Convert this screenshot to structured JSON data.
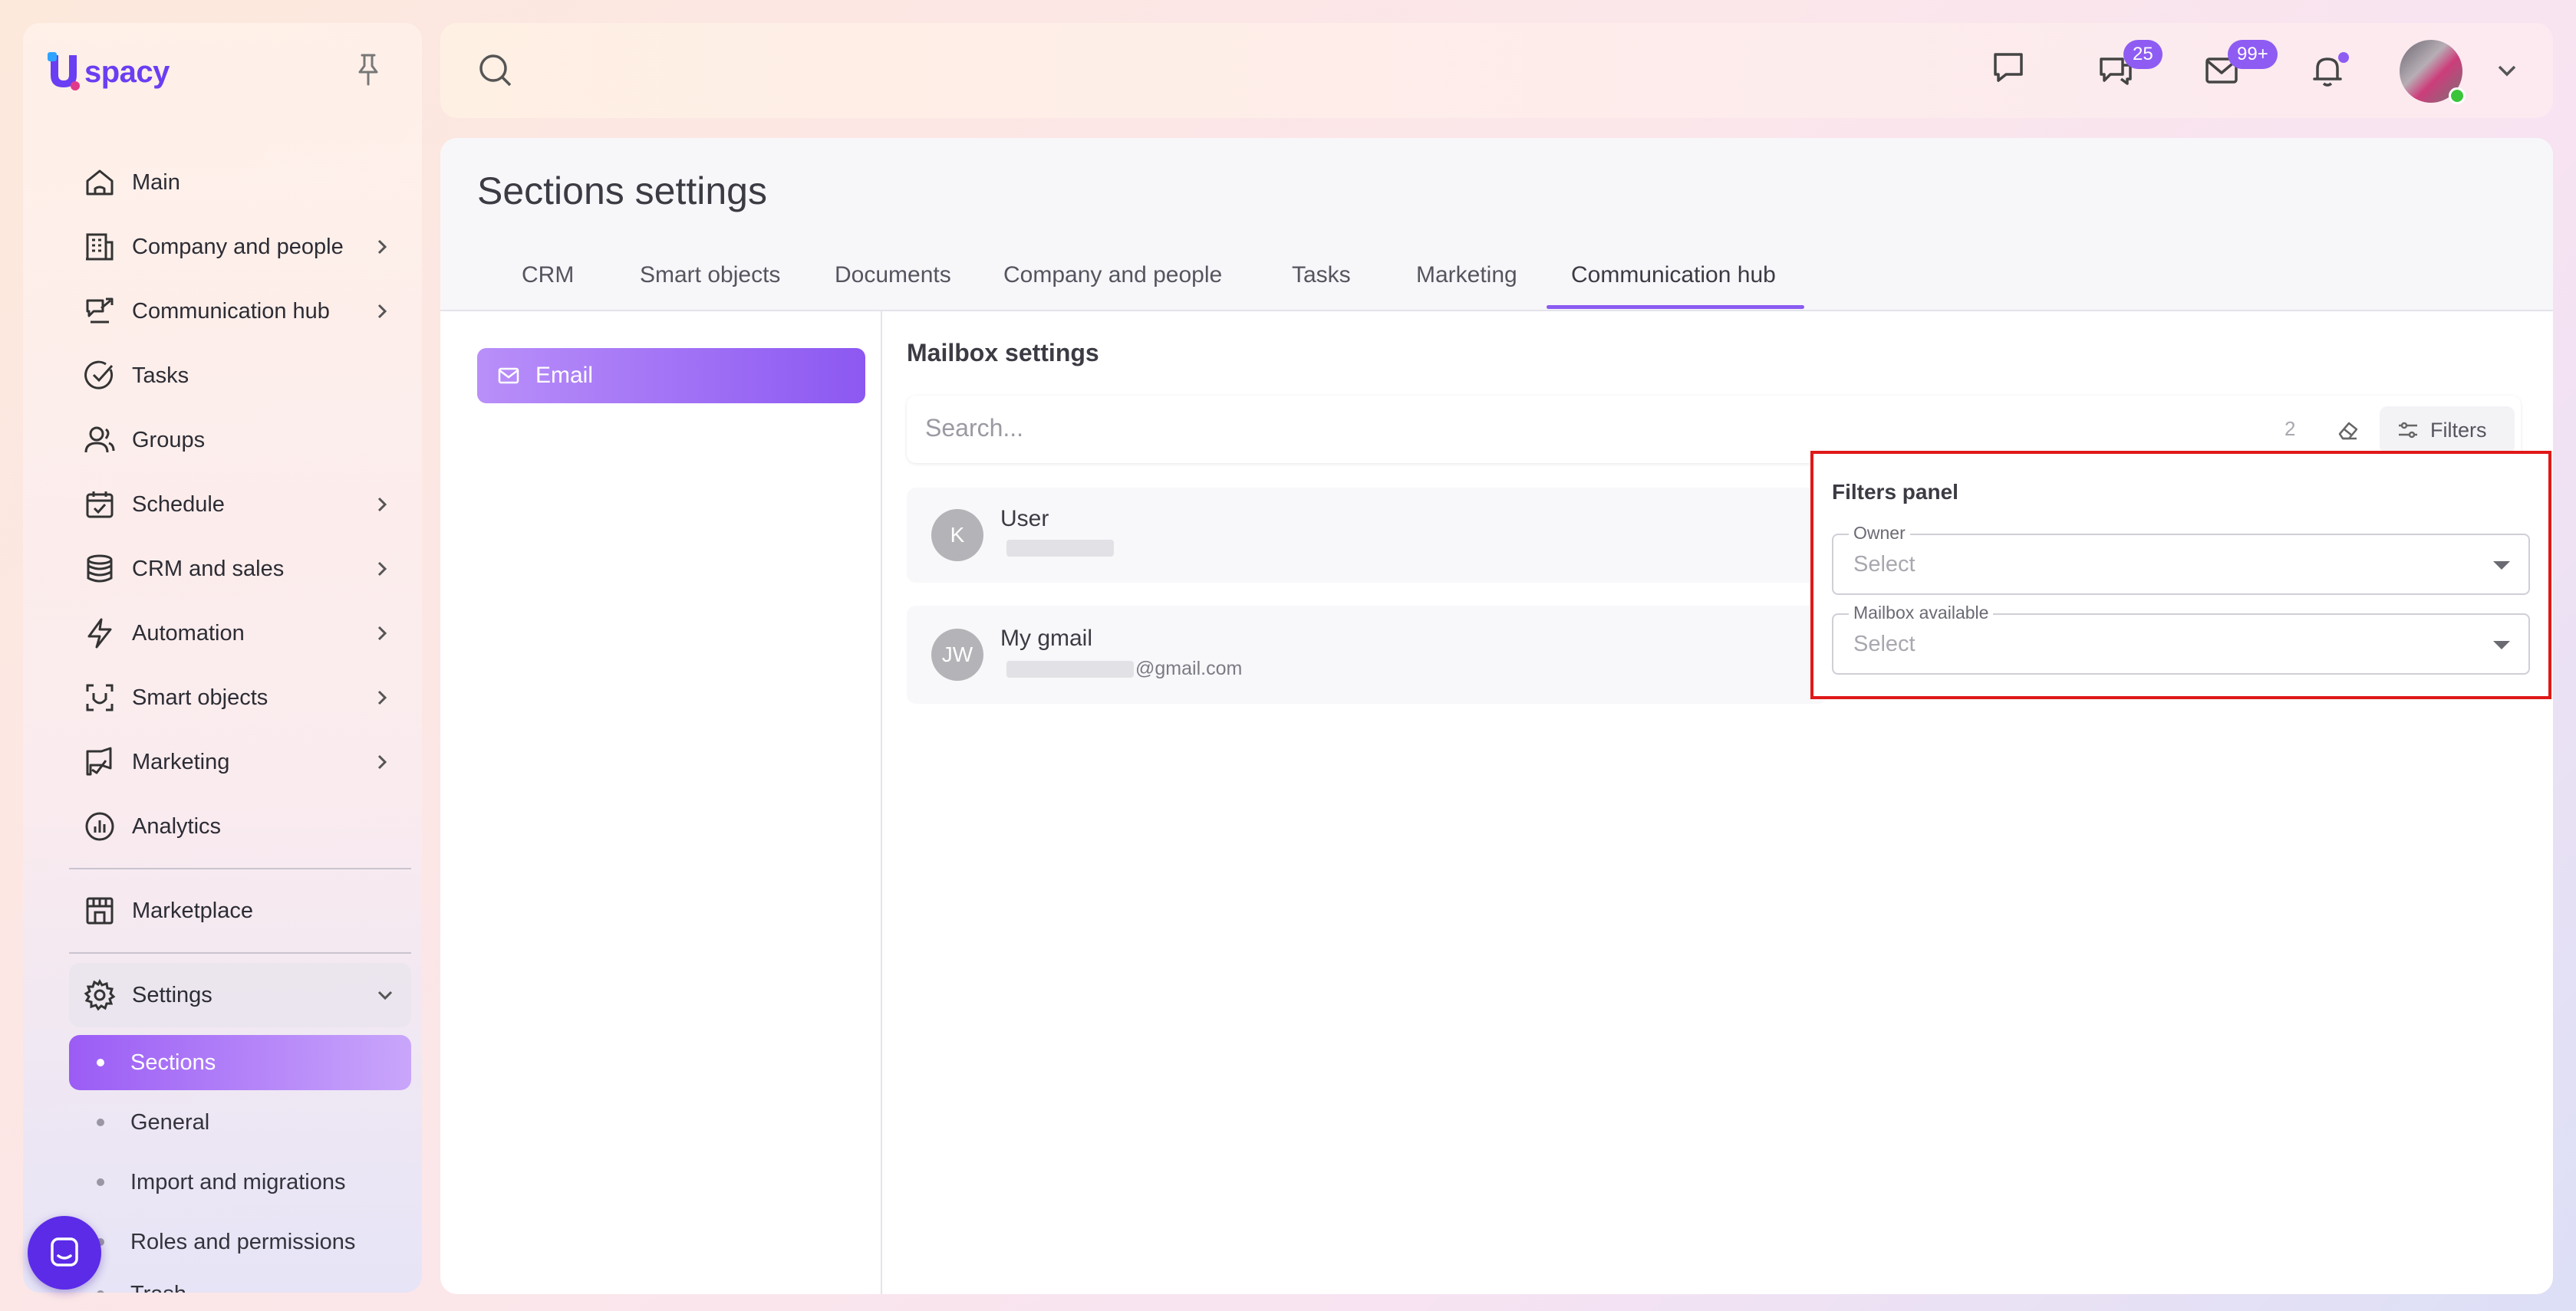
{
  "app": {
    "logo_letter": "U",
    "logo_text": "spacy"
  },
  "sidebar": {
    "items": [
      {
        "label": "Main",
        "icon": "home-icon",
        "has_chevron": false
      },
      {
        "label": "Company and people",
        "icon": "building-icon",
        "has_chevron": true
      },
      {
        "label": "Communication hub",
        "icon": "chat-hub-icon",
        "has_chevron": true
      },
      {
        "label": "Tasks",
        "icon": "check-circle-icon",
        "has_chevron": false
      },
      {
        "label": "Groups",
        "icon": "users-icon",
        "has_chevron": false
      },
      {
        "label": "Schedule",
        "icon": "calendar-icon",
        "has_chevron": true
      },
      {
        "label": "CRM and sales",
        "icon": "database-icon",
        "has_chevron": true
      },
      {
        "label": "Automation",
        "icon": "lightning-icon",
        "has_chevron": true
      },
      {
        "label": "Smart objects",
        "icon": "scan-face-icon",
        "has_chevron": true
      },
      {
        "label": "Marketing",
        "icon": "megaphone-icon",
        "has_chevron": true
      },
      {
        "label": "Analytics",
        "icon": "chart-icon",
        "has_chevron": false
      }
    ],
    "marketplace": "Marketplace",
    "settings": "Settings",
    "settings_sub": [
      "Sections",
      "General",
      "Import and migrations",
      "Roles and permissions",
      "Trash"
    ]
  },
  "topbar": {
    "chat_badge": "25",
    "mail_badge": "99+"
  },
  "page": {
    "title": "Sections settings",
    "tabs": [
      "CRM",
      "Smart objects",
      "Documents",
      "Company and people",
      "Tasks",
      "Marketing",
      "Communication hub"
    ],
    "active_tab": "Communication hub"
  },
  "left_menu": {
    "email": "Email"
  },
  "mailbox": {
    "title": "Mailbox settings",
    "search_placeholder": "Search...",
    "count": "2",
    "filters_label": "Filters",
    "rows": [
      {
        "initials": "K",
        "name": "User",
        "email": ""
      },
      {
        "initials": "JW",
        "name": "My gmail",
        "email": "@gmail.com"
      }
    ]
  },
  "filters_panel": {
    "title": "Filters panel",
    "fields": [
      {
        "label": "Owner",
        "value": "Select"
      },
      {
        "label": "Mailbox available",
        "value": "Select"
      }
    ]
  },
  "colors": {
    "accent": "#8a5cf0",
    "highlight_border": "#e01818",
    "badge": "#8e5cf3"
  }
}
